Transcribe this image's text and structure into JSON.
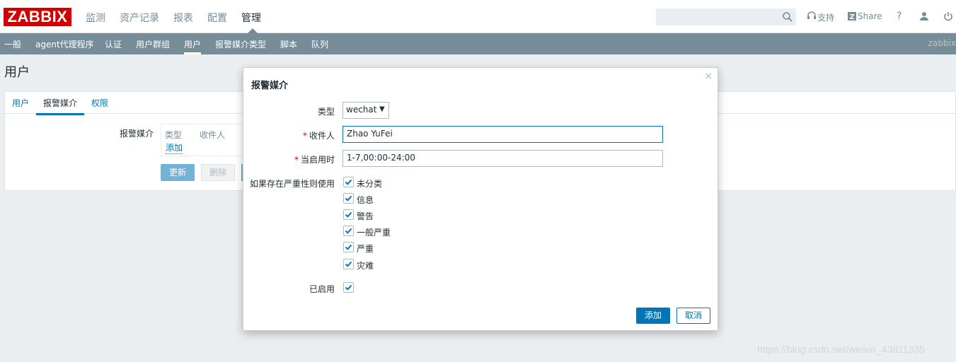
{
  "app": {
    "logo": "ZABBIX"
  },
  "topnav": [
    "监测",
    "资产记录",
    "报表",
    "配置",
    "管理"
  ],
  "toplinks": {
    "support": "支持",
    "share": "Share",
    "help": "?"
  },
  "subnav": {
    "items": [
      "一般",
      "agent代理程序",
      "认证",
      "用户群组",
      "用户",
      "报警媒介类型",
      "脚本",
      "队列"
    ],
    "right": "zabbix"
  },
  "page": {
    "title": "用户"
  },
  "tabs": [
    "用户",
    "报警媒介",
    "权限"
  ],
  "media": {
    "label": "报警媒介",
    "col_type": "类型",
    "col_recipient": "收件人",
    "add": "添加"
  },
  "actions": {
    "update": "更新",
    "delete": "删除"
  },
  "dialog": {
    "title": "报警媒介",
    "close": "×",
    "type_label": "类型",
    "type_value": "wechat",
    "recipient_label": "收件人",
    "recipient_value": "Zhao YuFei",
    "when_label": "当启用时",
    "when_value": "1-7,00:00-24:00",
    "severity_label": "如果存在严重性则使用",
    "severities": [
      "未分类",
      "信息",
      "警告",
      "一般严重",
      "严重",
      "灾难"
    ],
    "enabled_label": "已启用",
    "add_button": "添加",
    "cancel_button": "取消"
  },
  "watermark": "https://blog.csdn.net/weixin_43811335",
  "colors": {
    "brand": "#d40000",
    "accent": "#0275b8",
    "nav": "#768d99"
  }
}
